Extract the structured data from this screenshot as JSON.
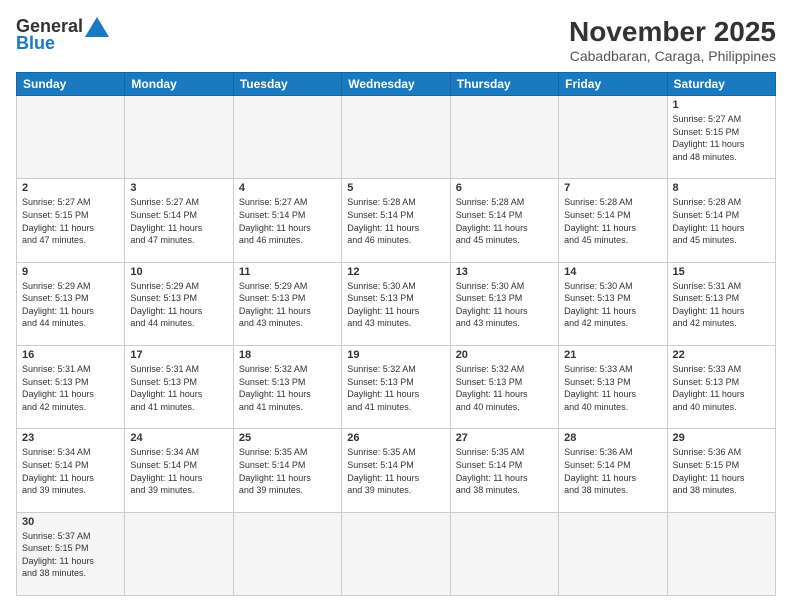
{
  "logo": {
    "general": "General",
    "blue": "Blue"
  },
  "title": {
    "month": "November 2025",
    "location": "Cabadbaran, Caraga, Philippines"
  },
  "days_of_week": [
    "Sunday",
    "Monday",
    "Tuesday",
    "Wednesday",
    "Thursday",
    "Friday",
    "Saturday"
  ],
  "weeks": [
    {
      "days": [
        {
          "num": null,
          "info": null
        },
        {
          "num": null,
          "info": null
        },
        {
          "num": null,
          "info": null
        },
        {
          "num": null,
          "info": null
        },
        {
          "num": null,
          "info": null
        },
        {
          "num": null,
          "info": null
        },
        {
          "num": "1",
          "info": "Sunrise: 5:27 AM\nSunset: 5:15 PM\nDaylight: 11 hours\nand 48 minutes."
        }
      ]
    },
    {
      "days": [
        {
          "num": "2",
          "info": "Sunrise: 5:27 AM\nSunset: 5:15 PM\nDaylight: 11 hours\nand 47 minutes."
        },
        {
          "num": "3",
          "info": "Sunrise: 5:27 AM\nSunset: 5:14 PM\nDaylight: 11 hours\nand 47 minutes."
        },
        {
          "num": "4",
          "info": "Sunrise: 5:27 AM\nSunset: 5:14 PM\nDaylight: 11 hours\nand 46 minutes."
        },
        {
          "num": "5",
          "info": "Sunrise: 5:28 AM\nSunset: 5:14 PM\nDaylight: 11 hours\nand 46 minutes."
        },
        {
          "num": "6",
          "info": "Sunrise: 5:28 AM\nSunset: 5:14 PM\nDaylight: 11 hours\nand 45 minutes."
        },
        {
          "num": "7",
          "info": "Sunrise: 5:28 AM\nSunset: 5:14 PM\nDaylight: 11 hours\nand 45 minutes."
        },
        {
          "num": "8",
          "info": "Sunrise: 5:28 AM\nSunset: 5:14 PM\nDaylight: 11 hours\nand 45 minutes."
        }
      ]
    },
    {
      "days": [
        {
          "num": "9",
          "info": "Sunrise: 5:29 AM\nSunset: 5:13 PM\nDaylight: 11 hours\nand 44 minutes."
        },
        {
          "num": "10",
          "info": "Sunrise: 5:29 AM\nSunset: 5:13 PM\nDaylight: 11 hours\nand 44 minutes."
        },
        {
          "num": "11",
          "info": "Sunrise: 5:29 AM\nSunset: 5:13 PM\nDaylight: 11 hours\nand 43 minutes."
        },
        {
          "num": "12",
          "info": "Sunrise: 5:30 AM\nSunset: 5:13 PM\nDaylight: 11 hours\nand 43 minutes."
        },
        {
          "num": "13",
          "info": "Sunrise: 5:30 AM\nSunset: 5:13 PM\nDaylight: 11 hours\nand 43 minutes."
        },
        {
          "num": "14",
          "info": "Sunrise: 5:30 AM\nSunset: 5:13 PM\nDaylight: 11 hours\nand 42 minutes."
        },
        {
          "num": "15",
          "info": "Sunrise: 5:31 AM\nSunset: 5:13 PM\nDaylight: 11 hours\nand 42 minutes."
        }
      ]
    },
    {
      "days": [
        {
          "num": "16",
          "info": "Sunrise: 5:31 AM\nSunset: 5:13 PM\nDaylight: 11 hours\nand 42 minutes."
        },
        {
          "num": "17",
          "info": "Sunrise: 5:31 AM\nSunset: 5:13 PM\nDaylight: 11 hours\nand 41 minutes."
        },
        {
          "num": "18",
          "info": "Sunrise: 5:32 AM\nSunset: 5:13 PM\nDaylight: 11 hours\nand 41 minutes."
        },
        {
          "num": "19",
          "info": "Sunrise: 5:32 AM\nSunset: 5:13 PM\nDaylight: 11 hours\nand 41 minutes."
        },
        {
          "num": "20",
          "info": "Sunrise: 5:32 AM\nSunset: 5:13 PM\nDaylight: 11 hours\nand 40 minutes."
        },
        {
          "num": "21",
          "info": "Sunrise: 5:33 AM\nSunset: 5:13 PM\nDaylight: 11 hours\nand 40 minutes."
        },
        {
          "num": "22",
          "info": "Sunrise: 5:33 AM\nSunset: 5:13 PM\nDaylight: 11 hours\nand 40 minutes."
        }
      ]
    },
    {
      "days": [
        {
          "num": "23",
          "info": "Sunrise: 5:34 AM\nSunset: 5:14 PM\nDaylight: 11 hours\nand 39 minutes."
        },
        {
          "num": "24",
          "info": "Sunrise: 5:34 AM\nSunset: 5:14 PM\nDaylight: 11 hours\nand 39 minutes."
        },
        {
          "num": "25",
          "info": "Sunrise: 5:35 AM\nSunset: 5:14 PM\nDaylight: 11 hours\nand 39 minutes."
        },
        {
          "num": "26",
          "info": "Sunrise: 5:35 AM\nSunset: 5:14 PM\nDaylight: 11 hours\nand 39 minutes."
        },
        {
          "num": "27",
          "info": "Sunrise: 5:35 AM\nSunset: 5:14 PM\nDaylight: 11 hours\nand 38 minutes."
        },
        {
          "num": "28",
          "info": "Sunrise: 5:36 AM\nSunset: 5:14 PM\nDaylight: 11 hours\nand 38 minutes."
        },
        {
          "num": "29",
          "info": "Sunrise: 5:36 AM\nSunset: 5:15 PM\nDaylight: 11 hours\nand 38 minutes."
        }
      ]
    },
    {
      "days": [
        {
          "num": "30",
          "info": "Sunrise: 5:37 AM\nSunset: 5:15 PM\nDaylight: 11 hours\nand 38 minutes."
        },
        {
          "num": null,
          "info": null
        },
        {
          "num": null,
          "info": null
        },
        {
          "num": null,
          "info": null
        },
        {
          "num": null,
          "info": null
        },
        {
          "num": null,
          "info": null
        },
        {
          "num": null,
          "info": null
        }
      ]
    }
  ]
}
